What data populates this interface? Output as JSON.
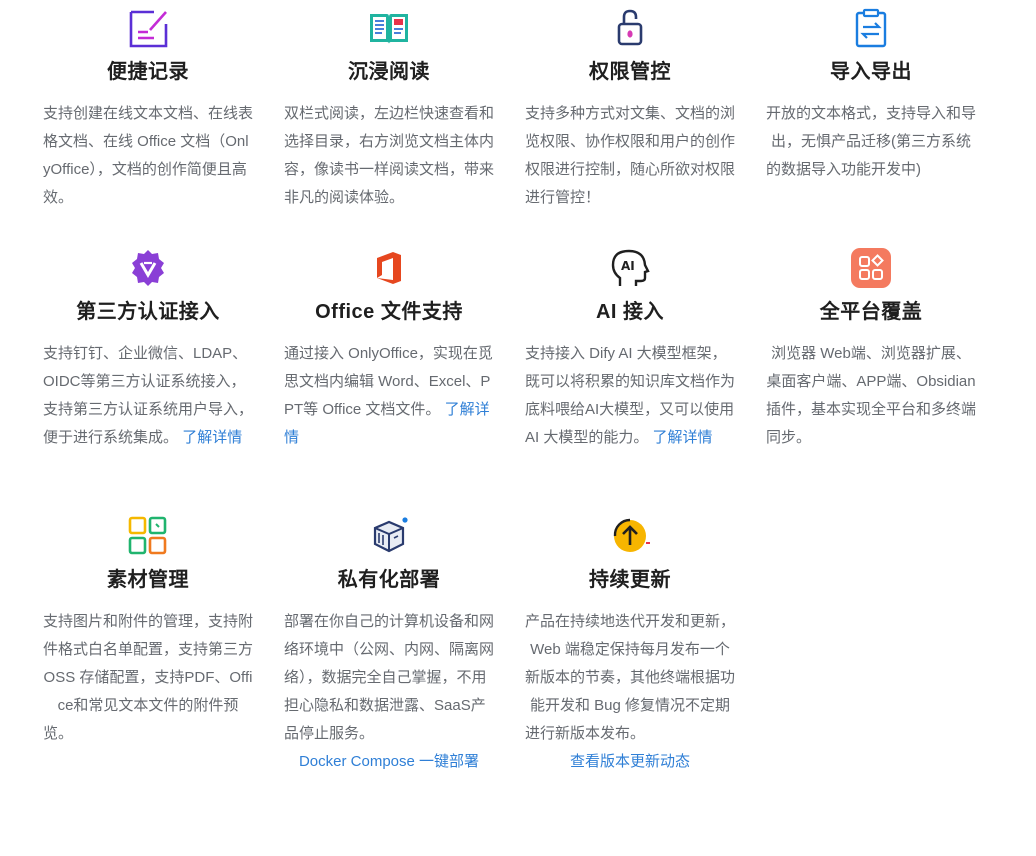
{
  "features": [
    {
      "icon": "note-edit-icon",
      "title": "便捷记录",
      "desc": "支持创建在线文本文档、在线表格文档、在线 Office 文档（OnlyOffice），文档的创作简便且高效。"
    },
    {
      "icon": "open-book-icon",
      "title": "沉浸阅读",
      "desc": "双栏式阅读，左边栏快速查看和选择目录，右方浏览文档主体内容，像读书一样阅读文档，带来非凡的阅读体验。"
    },
    {
      "icon": "lock-icon",
      "title": "权限管控",
      "desc": "支持多种方式对文集、文档的浏览权限、协作权限和用户的创作权限进行控制，随心所欲对权限进行管控！"
    },
    {
      "icon": "import-export-icon",
      "title": "导入导出",
      "desc": "开放的文本格式，支持导入和导出，无惧产品迁移(第三方系统的数据导入功能开发中)"
    },
    {
      "icon": "verified-badge-icon",
      "title": "第三方认证接入",
      "desc": "支持钉钉、企业微信、LDAP、OIDC等第三方认证系统接入，支持第三方认证系统用户导入，便于进行系统集成。",
      "link": "了解详情"
    },
    {
      "icon": "office-icon",
      "title": "Office 文件支持",
      "desc": "通过接入 OnlyOffice，实现在觅思文档内编辑 Word、Excel、PPT等 Office 文档文件。",
      "link": "了解详情"
    },
    {
      "icon": "ai-head-icon",
      "title": "AI 接入",
      "desc": "支持接入 Dify AI 大模型框架，既可以将积累的知识库文档作为底料喂给AI大模型，又可以使用 AI 大模型的能力。",
      "link": "了解详情"
    },
    {
      "icon": "apps-grid-icon",
      "title": "全平台覆盖",
      "desc": "浏览器 Web端、浏览器扩展、桌面客户端、APP端、Obsidian 插件，基本实现全平台和多终端同步。"
    },
    {
      "icon": "material-grid-icon",
      "title": "素材管理",
      "desc": "支持图片和附件的管理，支持附件格式白名单配置，支持第三方 OSS 存储配置，支持PDF、Office和常见文本文件的附件预览。"
    },
    {
      "icon": "cube-deploy-icon",
      "title": "私有化部署",
      "desc": "部署在你自己的计算机设备和网络环境中（公网、内网、隔离网络），数据完全自己掌握，不用担心隐私和数据泄露、SaaS产品停止服务。",
      "link": "Docker Compose 一键部署"
    },
    {
      "icon": "arrow-up-circle-icon",
      "title": "持续更新",
      "desc": "产品在持续地迭代开发和更新，Web 端稳定保持每月发布一个新版本的节奏，其他终端根据功能开发和 Bug 修复情况不定期进行新版本发布。",
      "link": "查看版本更新动态"
    }
  ],
  "colors": {
    "link": "#2f7fd6",
    "title": "#1f1f1f",
    "text": "#666a70"
  }
}
